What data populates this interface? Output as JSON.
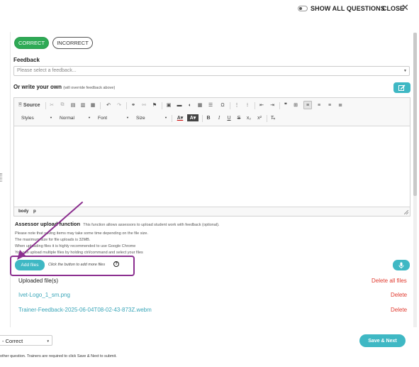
{
  "header": {
    "show_all_label": "SHOW ALL QUESTIONS",
    "close_label": "CLOSE",
    "close_icon": "close-icon"
  },
  "grading": {
    "correct_label": "CORRECT",
    "incorrect_label": "INCORRECT",
    "selected": "CORRECT"
  },
  "feedback": {
    "label": "Feedback",
    "placeholder": "Please select a feedback..."
  },
  "own": {
    "label": "Or write your own",
    "note": "(will override feedback above)"
  },
  "editor": {
    "source_label": "Source",
    "styles_label": "Styles",
    "format_label": "Normal",
    "font_label": "Font",
    "size_label": "Size",
    "status_body": "body",
    "status_p": "p"
  },
  "assessor": {
    "title": "Assessor upload function",
    "description": "This function allows assessors to upload student work with feedback (optional).",
    "notes": [
      "Please note that saving items may take some time depending on the file size.",
      "The maximum size for file uploads is 32MB.",
      "When uploading files it is highly recommended to use Google Chrome",
      "You can upload multiple files by holding ctrl/command and select your files"
    ],
    "add_files_label": "Add files",
    "add_files_hint": "Click the button to add more files",
    "help_icon": "?"
  },
  "uploads": {
    "title": "Uploaded file(s)",
    "delete_all_label": "Delete all files",
    "files": [
      {
        "name": "Ivet-Logo_1_sm.png",
        "delete_label": "Delete"
      },
      {
        "name": "Trainer-Feedback-2025-06-04T08-02-43-873Z.webm",
        "delete_label": "Delete"
      }
    ]
  },
  "footer": {
    "status_value": "- Correct",
    "save_next_label": "Save & Next",
    "note": "other question. Trainers are required to click Save & Next to submit."
  },
  "colors": {
    "accent": "#3fb8c4",
    "correct": "#2eaa55",
    "danger": "#e03a2f",
    "annotation": "#8b2f8f"
  }
}
